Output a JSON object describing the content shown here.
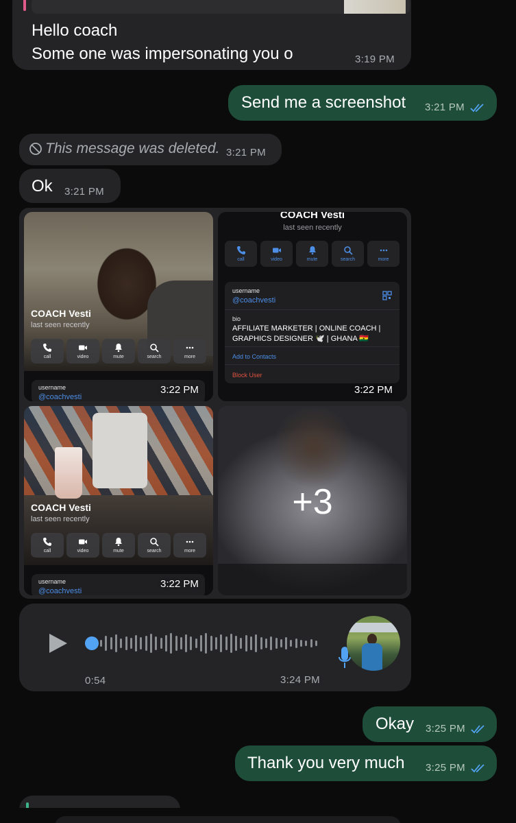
{
  "messages": {
    "m1": {
      "line1": "Hello coach",
      "line2": "Some one was impersonating you o",
      "time": "3:19 PM"
    },
    "m2": {
      "text": "Send me a screenshot",
      "time": "3:21 PM"
    },
    "m3": {
      "text": "This message was deleted.",
      "time": "3:21 PM"
    },
    "m4": {
      "text": "Ok",
      "time": "3:21 PM"
    },
    "m5": {
      "text": "Okay",
      "time": "3:25 PM"
    },
    "m6": {
      "text": "Thank you very much",
      "time": "3:25 PM"
    }
  },
  "album": {
    "shot1": {
      "name": "COACH Vesti",
      "status": "last seen recently",
      "actions": [
        "call",
        "video",
        "mute",
        "search",
        "more"
      ],
      "username_label": "username",
      "username": "@coachvesti",
      "time": "3:22 PM"
    },
    "shot2": {
      "name": "COACH Vesti",
      "status": "last seen recently",
      "actions": [
        "call",
        "video",
        "mute",
        "search",
        "more"
      ],
      "username_label": "username",
      "username": "@coachvesti",
      "bio_label": "bio",
      "bio_line1": "AFFILIATE MARKETER | ONLINE COACH |",
      "bio_line2": "GRAPHICS DESIGNER 🕊️ | GHANA 🇬🇭",
      "add_contact": "Add to Contacts",
      "block": "Block User",
      "time": "3:22 PM"
    },
    "shot3": {
      "name": "COACH Vesti",
      "status": "last seen recently",
      "actions": [
        "call",
        "video",
        "mute",
        "search",
        "more"
      ],
      "username_label": "username",
      "username": "@coachvesti",
      "time": "3:22 PM"
    },
    "more_count": "+3"
  },
  "voice": {
    "duration": "0:54",
    "time": "3:24 PM",
    "progress": 0
  },
  "colors": {
    "background": "#0b0b0c",
    "incoming_bubble": "#242426",
    "outgoing_bubble": "#1e4e3a",
    "link_blue": "#4d8ee6",
    "read_ticks": "#53a3f5",
    "block_red": "#e2533f"
  },
  "icons": [
    "blocked-icon",
    "double-check-icon",
    "play-icon",
    "mic-icon",
    "phone-icon",
    "video-icon",
    "bell-icon",
    "search-icon",
    "more-icon",
    "qr-icon"
  ]
}
